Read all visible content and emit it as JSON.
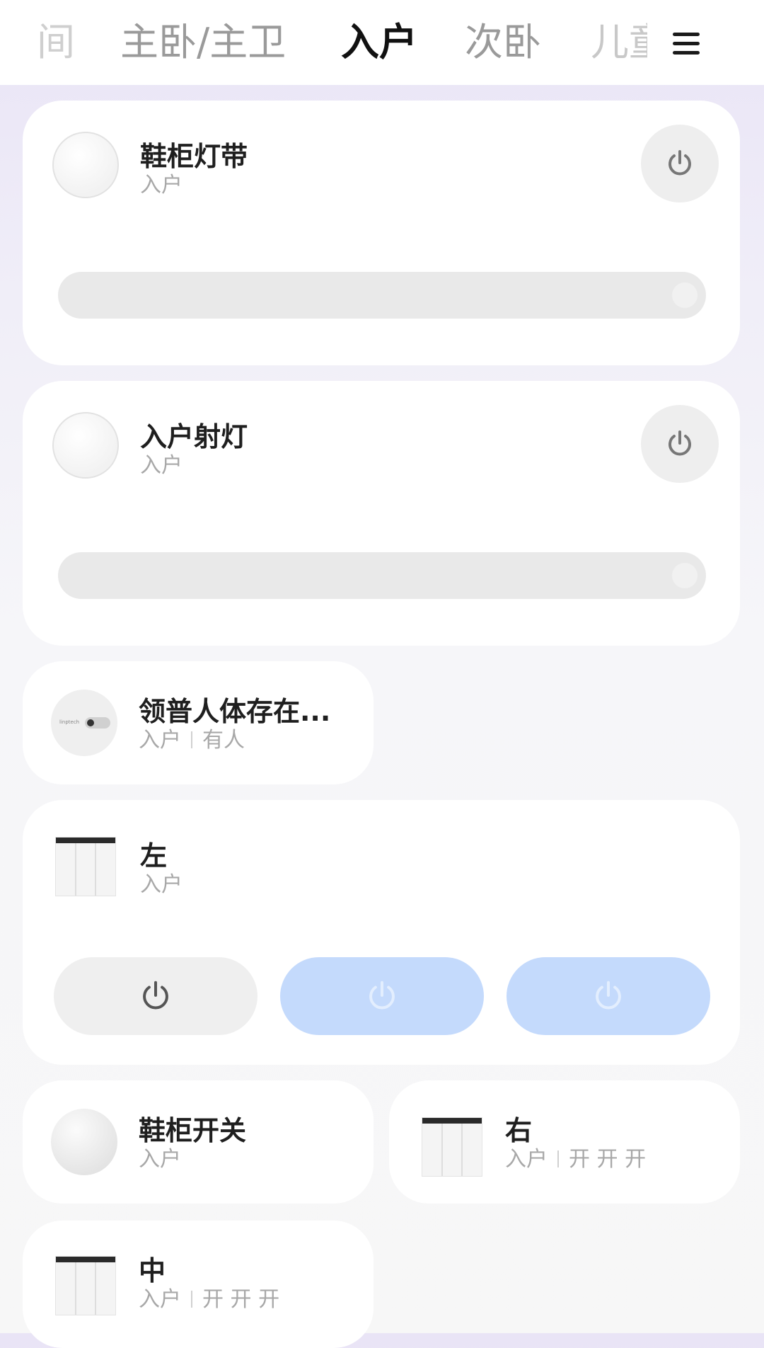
{
  "tabs": [
    {
      "label": "间"
    },
    {
      "label": "主卧/主卫"
    },
    {
      "label": "入户"
    },
    {
      "label": "次卧"
    },
    {
      "label": "儿童"
    }
  ],
  "menu_icon": "hamburger-menu-icon",
  "devices": [
    {
      "name": "鞋柜灯带",
      "room": "入户",
      "icon": "light-bulb-icon",
      "control": "power-button",
      "brightness": 1.0
    },
    {
      "name": "入户射灯",
      "room": "入户",
      "icon": "light-bulb-icon",
      "control": "power-button",
      "brightness": 1.0
    },
    {
      "name": "领普人体存在...",
      "room": "入户",
      "status": "有人",
      "icon": "presence-sensor-icon",
      "icon_text": "linptech"
    },
    {
      "name": "左",
      "room": "入户",
      "icon": "wall-switch-panel-icon",
      "buttons": [
        {
          "state": "off",
          "icon": "power-icon"
        },
        {
          "state": "on",
          "icon": "power-icon"
        },
        {
          "state": "on",
          "icon": "power-icon"
        }
      ]
    },
    {
      "name": "鞋柜开关",
      "room": "入户",
      "icon": "round-switch-icon"
    },
    {
      "name": "右",
      "room": "入户",
      "status": "开 开 开",
      "icon": "wall-switch-panel-icon"
    },
    {
      "name": "中",
      "room": "入户",
      "status": "开 开 开",
      "icon": "wall-switch-panel-icon"
    }
  ],
  "colors": {
    "active_pill": "#c4dafc",
    "inactive_pill": "#efefef",
    "card": "#ffffff"
  }
}
